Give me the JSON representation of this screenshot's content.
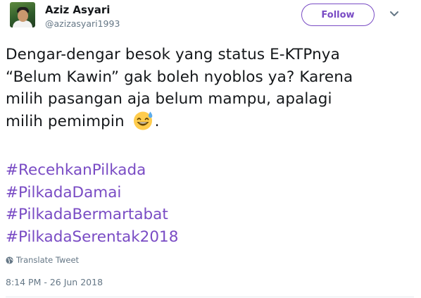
{
  "author": {
    "display_name": "Aziz Asyari",
    "handle": "@azizasyari1993"
  },
  "actions": {
    "follow_label": "Follow"
  },
  "tweet": {
    "lines": [
      "Dengar-dengar besok yang status E-KTPnya",
      "“Belum Kawin” gak boleh nyoblos ya? Karena",
      "milih pasangan aja belum mampu, apalagi",
      "milih pemimpin"
    ],
    "after_emoji": ".",
    "emoji": "grinning-sweat-face",
    "hashtags": [
      "#RecehkanPilkada",
      "#PilkadaDamai",
      "#PilkadaBermartabat",
      "#PilkadaSerentak2018"
    ]
  },
  "translate_label": "Translate Tweet",
  "timestamp": "8:14 PM - 26 Jun 2018",
  "colors": {
    "accent": "#794bc4",
    "secondary_text": "#657786",
    "primary_text": "#14171a"
  }
}
